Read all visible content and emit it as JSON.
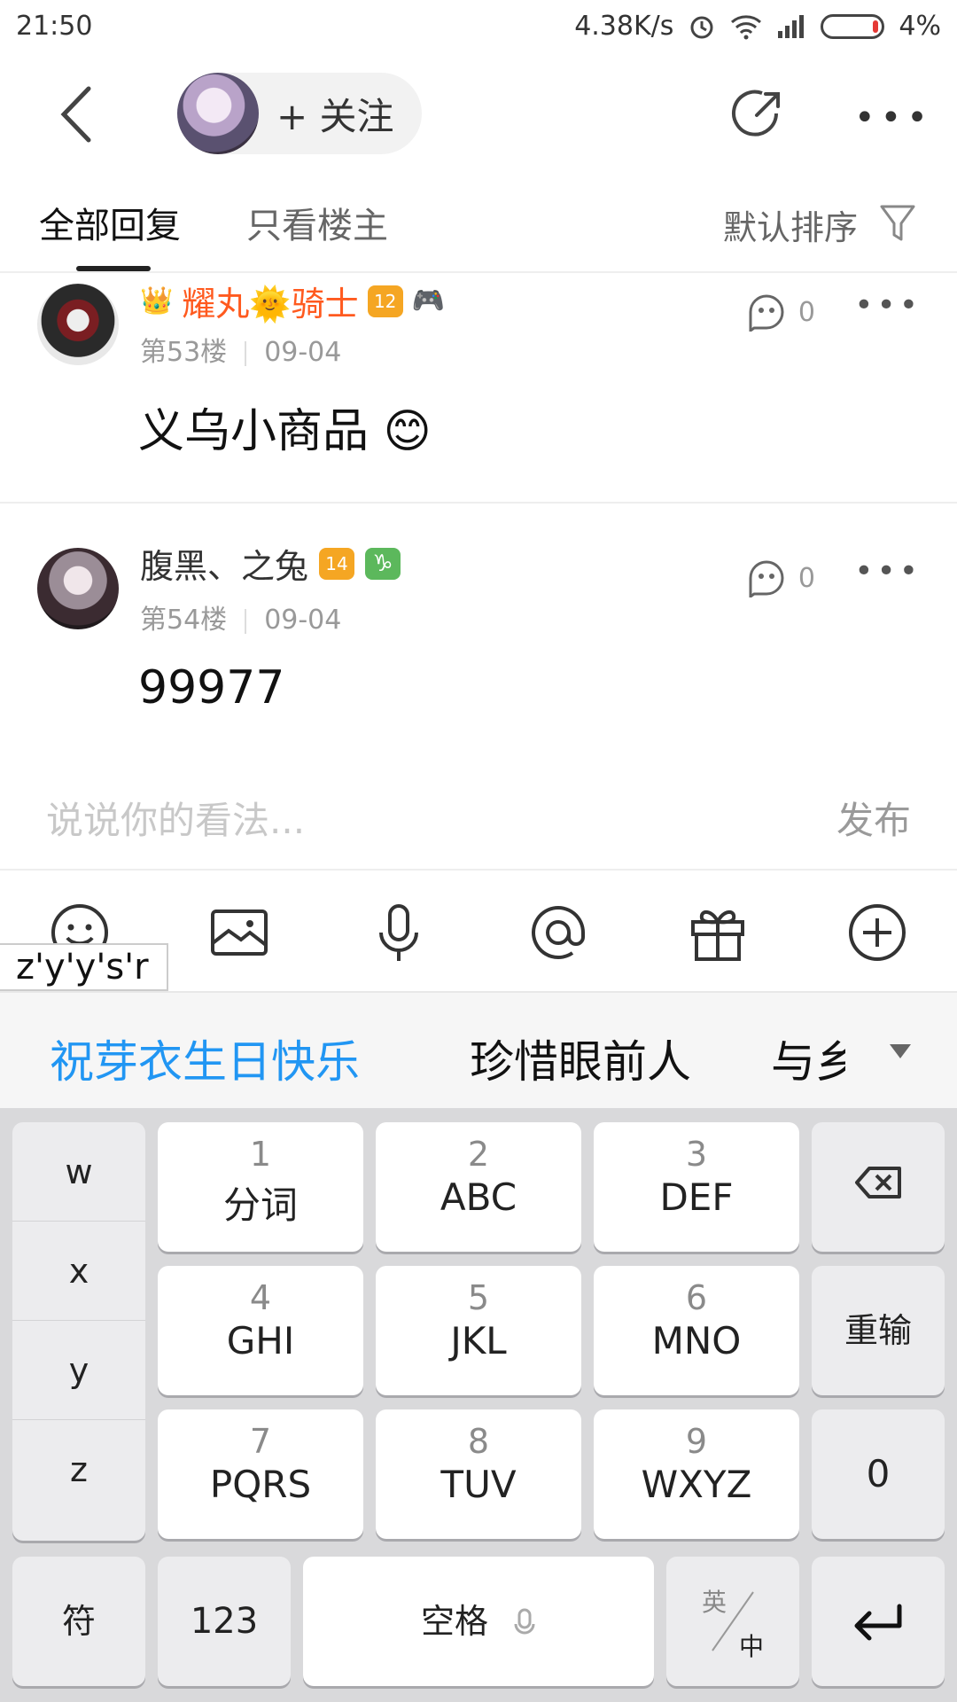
{
  "status_bar": {
    "time": "21:50",
    "net_speed": "4.38K/s",
    "battery": "4%"
  },
  "top_nav": {
    "follow_label": "+ 关注"
  },
  "tabs": {
    "all": "全部回复",
    "op_only": "只看楼主",
    "sort": "默认排序"
  },
  "posts": [
    {
      "username": "耀丸🌞骑士",
      "username_color": "#ff5a1f",
      "level": "12",
      "floor": "第53楼",
      "date": "09-04",
      "content": "义乌小商品 😊",
      "likes": "0"
    },
    {
      "username": "腹黑、之兔",
      "username_color": "#333333",
      "level": "14",
      "zodiac": "♑",
      "floor": "第54楼",
      "date": "09-04",
      "content": "99977",
      "likes": "0"
    }
  ],
  "comment_bar": {
    "placeholder": "说说你的看法...",
    "publish": "发布"
  },
  "toolbar": {
    "icons": [
      "emoji-icon",
      "image-icon",
      "microphone-icon",
      "at-icon",
      "gift-icon",
      "plus-icon"
    ]
  },
  "ime": {
    "composing": "z'y'y's'r",
    "suggestions": [
      "祝芽衣生日快乐",
      "珍惜眼前人",
      "与乡"
    ],
    "suggestion_highlight_color": "#2196f3",
    "left_column": [
      "w",
      "x",
      "y",
      "z"
    ],
    "keys": [
      {
        "num": "1",
        "label": "分词"
      },
      {
        "num": "2",
        "label": "ABC"
      },
      {
        "num": "3",
        "label": "DEF"
      },
      {
        "num": "4",
        "label": "GHI"
      },
      {
        "num": "5",
        "label": "JKL"
      },
      {
        "num": "6",
        "label": "MNO"
      },
      {
        "num": "7",
        "label": "PQRS"
      },
      {
        "num": "8",
        "label": "TUV"
      },
      {
        "num": "9",
        "label": "WXYZ"
      }
    ],
    "reinput": "重输",
    "zero": "0",
    "symbol": "符",
    "num_mode": "123",
    "space": "空格",
    "lang_en": "英",
    "lang_zh": "中"
  }
}
